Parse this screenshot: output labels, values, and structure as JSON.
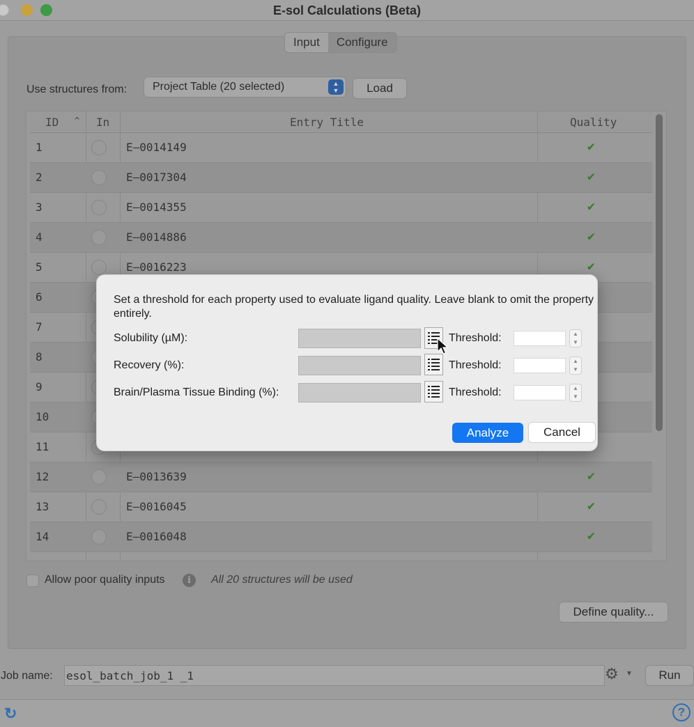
{
  "window": {
    "title": "E-sol Calculations (Beta)"
  },
  "tabs": [
    {
      "label": "Input"
    },
    {
      "label": "Configure"
    }
  ],
  "structures": {
    "label": "Use structures from:",
    "selected": "Project Table (20 selected)",
    "load_label": "Load"
  },
  "table": {
    "headers": {
      "id": "ID",
      "in": "In",
      "title": "Entry Title",
      "quality": "Quality"
    },
    "rows": [
      {
        "id": "1",
        "title": "E–0014149",
        "check": "✔"
      },
      {
        "id": "2",
        "title": "E–0017304",
        "check": "✔"
      },
      {
        "id": "3",
        "title": "E–0014355",
        "check": "✔"
      },
      {
        "id": "4",
        "title": "E–0014886",
        "check": "✔"
      },
      {
        "id": "5",
        "title": "E–0016223",
        "check": "✔"
      },
      {
        "id": "6",
        "title": "",
        "check": ""
      },
      {
        "id": "7",
        "title": "",
        "check": ""
      },
      {
        "id": "8",
        "title": "",
        "check": ""
      },
      {
        "id": "9",
        "title": "",
        "check": ""
      },
      {
        "id": "10",
        "title": "",
        "check": ""
      },
      {
        "id": "11",
        "title": "",
        "check": ""
      },
      {
        "id": "12",
        "title": "E–0013639",
        "check": "✔"
      },
      {
        "id": "13",
        "title": "E–0016045",
        "check": "✔"
      },
      {
        "id": "14",
        "title": "E–0016048",
        "check": "✔"
      }
    ]
  },
  "options": {
    "allow_label": "Allow poor quality inputs",
    "used_text": "All 20 structures will be used",
    "define_label": "Define quality..."
  },
  "job": {
    "label": "Job name:",
    "value": "esol_batch_job_1  _1",
    "run_label": "Run"
  },
  "dialog": {
    "message": "Set a threshold for each property used to evaluate ligand quality. Leave blank to omit the property entirely.",
    "properties": [
      {
        "label": "Solubility (µM):",
        "threshold_label": "Threshold:"
      },
      {
        "label": "Recovery (%):",
        "threshold_label": "Threshold:"
      },
      {
        "label": "Brain/Plasma Tissue Binding (%):",
        "threshold_label": "Threshold:"
      }
    ],
    "analyze_label": "Analyze",
    "cancel_label": "Cancel"
  },
  "colors": {
    "accent": "#1476f1",
    "check": "#3a7a2a",
    "help": "#2d6fb5"
  }
}
